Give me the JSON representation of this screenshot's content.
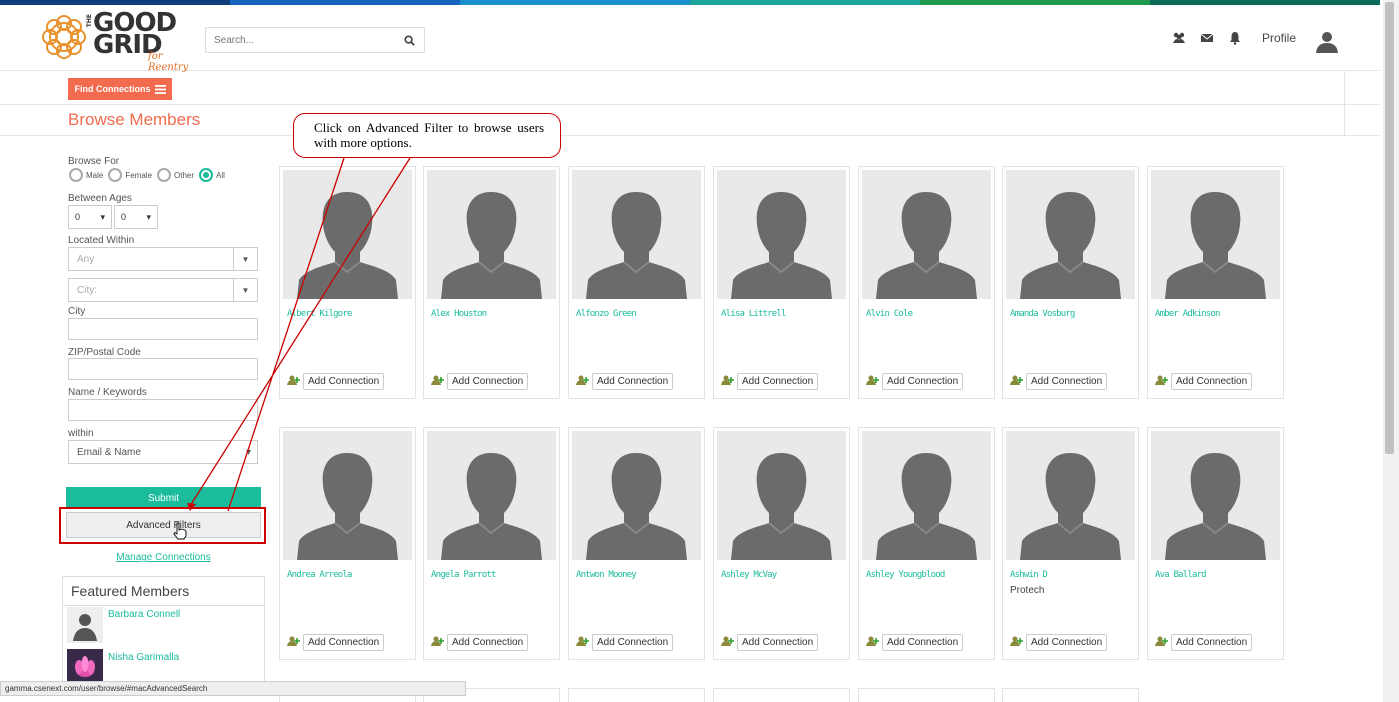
{
  "header": {
    "logo_top": "GOOD",
    "logo_bottom": "GRID",
    "logo_the": "THE",
    "logo_tagline": "for Reentry",
    "search_placeholder": "Search...",
    "profile_label": "Profile"
  },
  "find_connections": "Find Connections",
  "page_title": "Browse Members",
  "callout_text": "Click on Advanced Filter to browse users with more options.",
  "filters": {
    "browse_for": "Browse For",
    "gender_options": [
      "Male",
      "Female",
      "Other",
      "All"
    ],
    "between_ages": "Between Ages",
    "age_from": "0",
    "age_to": "0",
    "located_within": "Located Within",
    "located_placeholder": "Any",
    "city_placeholder": "City:",
    "city_label": "City",
    "zip_label": "ZIP/Postal Code",
    "keywords_label": "Name / Keywords",
    "within_label": "within",
    "within_value": "Email & Name",
    "submit": "Submit",
    "advanced": "Advanced Filters",
    "manage": "Manage Connections"
  },
  "featured": {
    "title": "Featured Members",
    "members": [
      "Barbara Connell",
      "Nisha Garimalla"
    ]
  },
  "members": [
    {
      "name": "Albert Kilgore",
      "subtitle": ""
    },
    {
      "name": "Alex Houston",
      "subtitle": ""
    },
    {
      "name": "Alfonzo Green",
      "subtitle": ""
    },
    {
      "name": "Alisa Littrell",
      "subtitle": ""
    },
    {
      "name": "Alvin Cole",
      "subtitle": ""
    },
    {
      "name": "Amanda Vosburg",
      "subtitle": ""
    },
    {
      "name": "Amber Adkinson",
      "subtitle": ""
    },
    {
      "name": "Andrea Arreola",
      "subtitle": ""
    },
    {
      "name": "Angela Parrott",
      "subtitle": ""
    },
    {
      "name": "Antwon Mooney",
      "subtitle": ""
    },
    {
      "name": "Ashley McVay",
      "subtitle": ""
    },
    {
      "name": "Ashley Youngblood",
      "subtitle": ""
    },
    {
      "name": "Ashwin D",
      "subtitle": "Protech"
    },
    {
      "name": "Ava Ballard",
      "subtitle": ""
    }
  ],
  "add_connection_label": "Add Connection",
  "status_url": "gamma.csenext.com/user/browse/#macAdvancedSearch",
  "colors": {
    "accent": "#f26b4f",
    "teal": "#1abc9c",
    "annotation": "#cc0000",
    "stripe": [
      "#0e3f7a",
      "#1565c0",
      "#1b8fc9",
      "#1ba39c",
      "#1e9a4a",
      "#0a6b5a"
    ]
  }
}
